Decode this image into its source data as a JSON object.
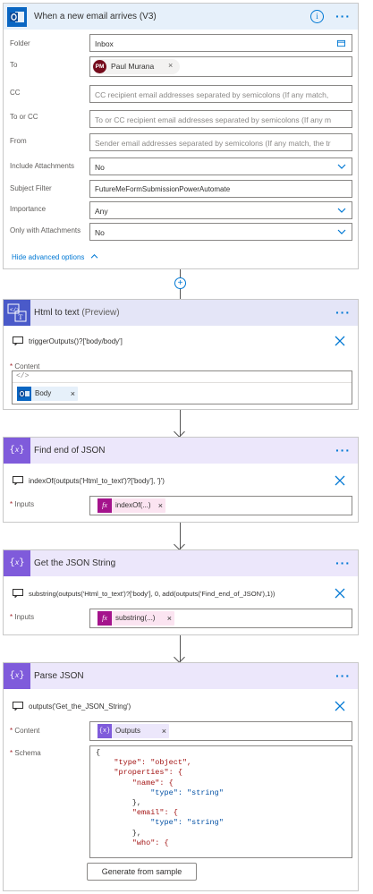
{
  "trigger": {
    "title": "When a new email arrives (V3)",
    "fields": [
      {
        "label": "Folder",
        "value": "Inbox"
      },
      {
        "label": "To",
        "chip_initials": "PM",
        "chip_name": "Paul Murana"
      },
      {
        "label": "CC",
        "placeholder": "CC recipient email addresses separated by semicolons (If any match,"
      },
      {
        "label": "To or CC",
        "placeholder": "To or CC recipient email addresses separated by semicolons (If any m"
      },
      {
        "label": "From",
        "placeholder": "Sender email addresses separated by semicolons (If any match, the tr"
      },
      {
        "label": "Include Attachments",
        "value": "No"
      },
      {
        "label": "Subject Filter",
        "value": "FutureMeFormSubmissionPowerAutomate"
      },
      {
        "label": "Importance",
        "value": "Any"
      },
      {
        "label": "Only with Attachments",
        "value": "No"
      }
    ],
    "advanced_link": "Hide advanced options"
  },
  "html_to_text": {
    "title": "Html to text",
    "title_suffix": "(Preview)",
    "expression": "triggerOutputs()?['body/body']",
    "content_label": "Content",
    "token": "Body"
  },
  "find_end": {
    "title": "Find end of JSON",
    "expression": "indexOf(outputs('Html_to_text')?['body'], '}')",
    "inputs_label": "Inputs",
    "token": "indexOf(...)"
  },
  "get_json": {
    "title": "Get the JSON String",
    "expression": "substring(outputs('Html_to_text')?['body'], 0, add(outputs('Find_end_of_JSON'),1))",
    "inputs_label": "Inputs",
    "token": "substring(...)"
  },
  "parse_json": {
    "title": "Parse JSON",
    "expression": "outputs('Get_the_JSON_String')",
    "content_label": "Content",
    "token": "Outputs",
    "schema_label": "Schema",
    "schema_lines": [
      "{",
      "    \"type\": \"object\",",
      "    \"properties\": {",
      "        \"name\": {",
      "            \"type\": \"string\"",
      "        },",
      "        \"email\": {",
      "            \"type\": \"string\"",
      "        },",
      "        \"who\": {"
    ],
    "generate_button": "Generate from sample"
  },
  "colors": {
    "outlook_header": "#e6f0fa",
    "html_header": "#e4e5f7",
    "compose_header": "#ece7fb",
    "outlook_icon": "#0a66c2",
    "html_icon": "#4a5ac9",
    "compose_icon": "#7f5bdb",
    "accent": "#0078d4"
  },
  "icons": [
    "outlook-icon",
    "info-icon",
    "more-options-icon",
    "folder-picker-icon",
    "chevron-down-icon",
    "chevron-up-icon",
    "add-step-icon",
    "html-to-text-icon",
    "compose-icon",
    "expression-icon",
    "remove-icon",
    "fx-icon",
    "down-arrow-icon"
  ]
}
